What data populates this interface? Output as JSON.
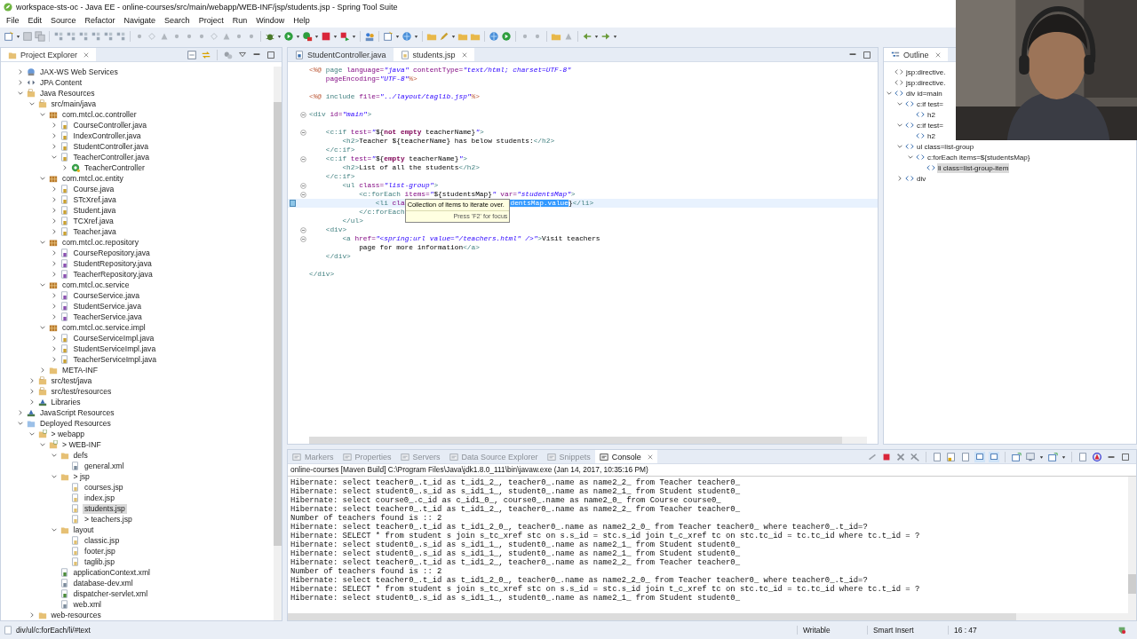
{
  "window": {
    "title": "workspace-sts-oc - Java EE - online-courses/src/main/webapp/WEB-INF/jsp/students.jsp - Spring Tool Suite"
  },
  "menu": [
    "File",
    "Edit",
    "Source",
    "Refactor",
    "Navigate",
    "Search",
    "Project",
    "Run",
    "Window",
    "Help"
  ],
  "project_explorer": {
    "title": "Project Explorer",
    "items": [
      {
        "label": "JAX-WS Web Services",
        "kind": "web-services",
        "expanded": false,
        "selected": false
      },
      {
        "label": "JPA Content",
        "kind": "jpa",
        "expanded": false,
        "selected": false
      },
      {
        "label": "Java Resources",
        "kind": "java-resources",
        "expanded": true,
        "selected": false,
        "children": [
          {
            "label": "src/main/java",
            "kind": "source-folder",
            "expanded": true,
            "selected": false,
            "children": [
              {
                "label": "com.mtcl.oc.controller",
                "kind": "package",
                "expanded": true,
                "selected": false,
                "children": [
                  {
                    "label": "CourseController.java",
                    "kind": "java-file",
                    "expanded": false,
                    "selected": false
                  },
                  {
                    "label": "IndexController.java",
                    "kind": "java-file",
                    "expanded": false,
                    "selected": false
                  },
                  {
                    "label": "StudentController.java",
                    "kind": "java-file",
                    "expanded": false,
                    "selected": false
                  },
                  {
                    "label": "TeacherController.java",
                    "kind": "java-file",
                    "expanded": true,
                    "selected": false,
                    "children": [
                      {
                        "label": "TeacherController",
                        "kind": "class",
                        "expanded": false,
                        "selected": false
                      }
                    ]
                  }
                ]
              },
              {
                "label": "com.mtcl.oc.entity",
                "kind": "package",
                "expanded": true,
                "selected": false,
                "children": [
                  {
                    "label": "Course.java",
                    "kind": "java-file",
                    "expanded": false,
                    "selected": false
                  },
                  {
                    "label": "STcXref.java",
                    "kind": "java-file",
                    "expanded": false,
                    "selected": false
                  },
                  {
                    "label": "Student.java",
                    "kind": "java-file",
                    "expanded": false,
                    "selected": false
                  },
                  {
                    "label": "TCXref.java",
                    "kind": "java-file",
                    "expanded": false,
                    "selected": false
                  },
                  {
                    "label": "Teacher.java",
                    "kind": "java-file",
                    "expanded": false,
                    "selected": false
                  }
                ]
              },
              {
                "label": "com.mtcl.oc.repository",
                "kind": "package",
                "expanded": true,
                "selected": false,
                "children": [
                  {
                    "label": "CourseRepository.java",
                    "kind": "interface-file",
                    "expanded": false,
                    "selected": false
                  },
                  {
                    "label": "StudentRepository.java",
                    "kind": "interface-file",
                    "expanded": false,
                    "selected": false
                  },
                  {
                    "label": "TeacherRepository.java",
                    "kind": "interface-file",
                    "expanded": false,
                    "selected": false
                  }
                ]
              },
              {
                "label": "com.mtcl.oc.service",
                "kind": "package",
                "expanded": true,
                "selected": false,
                "children": [
                  {
                    "label": "CourseService.java",
                    "kind": "interface-file",
                    "expanded": false,
                    "selected": false
                  },
                  {
                    "label": "StudentService.java",
                    "kind": "interface-file",
                    "expanded": false,
                    "selected": false
                  },
                  {
                    "label": "TeacherService.java",
                    "kind": "interface-file",
                    "expanded": false,
                    "selected": false
                  }
                ]
              },
              {
                "label": "com.mtcl.oc.service.impl",
                "kind": "package",
                "expanded": true,
                "selected": false,
                "children": [
                  {
                    "label": "CourseServiceImpl.java",
                    "kind": "java-file",
                    "expanded": false,
                    "selected": false
                  },
                  {
                    "label": "StudentServiceImpl.java",
                    "kind": "java-file",
                    "expanded": false,
                    "selected": false
                  },
                  {
                    "label": "TeacherServiceImpl.java",
                    "kind": "java-file",
                    "expanded": false,
                    "selected": false
                  }
                ]
              },
              {
                "label": "META-INF",
                "kind": "folder",
                "expanded": false,
                "selected": false
              }
            ]
          },
          {
            "label": "src/test/java",
            "kind": "source-folder",
            "expanded": false,
            "selected": false
          },
          {
            "label": "src/test/resources",
            "kind": "source-folder",
            "expanded": false,
            "selected": false
          },
          {
            "label": "Libraries",
            "kind": "libraries",
            "expanded": false,
            "selected": false
          }
        ]
      },
      {
        "label": "JavaScript Resources",
        "kind": "libraries",
        "expanded": false,
        "selected": false
      },
      {
        "label": "Deployed Resources",
        "kind": "deployed",
        "expanded": true,
        "selected": false,
        "children": [
          {
            "label": "> webapp",
            "kind": "web-folder",
            "expanded": true,
            "selected": false,
            "children": [
              {
                "label": "> WEB-INF",
                "kind": "web-folder",
                "expanded": true,
                "selected": false,
                "children": [
                  {
                    "label": "defs",
                    "kind": "folder",
                    "expanded": true,
                    "selected": false,
                    "children": [
                      {
                        "label": "general.xml",
                        "kind": "xml-file",
                        "selected": false
                      }
                    ]
                  },
                  {
                    "label": "> jsp",
                    "kind": "folder",
                    "expanded": true,
                    "selected": false,
                    "children": [
                      {
                        "label": "courses.jsp",
                        "kind": "jsp-file",
                        "selected": false
                      },
                      {
                        "label": "index.jsp",
                        "kind": "jsp-file",
                        "selected": false
                      },
                      {
                        "label": "students.jsp",
                        "kind": "jsp-file",
                        "selected": true
                      },
                      {
                        "label": "> teachers.jsp",
                        "kind": "jsp-file",
                        "selected": false
                      }
                    ]
                  },
                  {
                    "label": "layout",
                    "kind": "folder",
                    "expanded": true,
                    "selected": false,
                    "children": [
                      {
                        "label": "classic.jsp",
                        "kind": "jsp-file",
                        "selected": false
                      },
                      {
                        "label": "footer.jsp",
                        "kind": "jsp-file",
                        "selected": false
                      },
                      {
                        "label": "taglib.jsp",
                        "kind": "jsp-file",
                        "selected": false
                      }
                    ]
                  },
                  {
                    "label": "applicationContext.xml",
                    "kind": "spring-file",
                    "selected": false
                  },
                  {
                    "label": "database-dev.xml",
                    "kind": "xml-file",
                    "selected": false
                  },
                  {
                    "label": "dispatcher-servlet.xml",
                    "kind": "spring-file",
                    "selected": false
                  },
                  {
                    "label": "web.xml",
                    "kind": "xml-file",
                    "selected": false
                  }
                ]
              }
            ]
          },
          {
            "label": "web-resources",
            "kind": "folder",
            "expanded": false,
            "selected": false
          }
        ]
      }
    ]
  },
  "editor": {
    "tabs": [
      {
        "label": "StudentController.java",
        "selected": false
      },
      {
        "label": "students.jsp",
        "selected": true
      }
    ],
    "lines": [
      {
        "fold": false,
        "current": false,
        "segments": [
          {
            "kind": "delim",
            "text": "<%@"
          },
          {
            "kind": "tag",
            "text": " page"
          },
          {
            "kind": "attr",
            "text": " language="
          },
          {
            "kind": "string",
            "text": "\"java\""
          },
          {
            "kind": "attr",
            "text": " contentType="
          },
          {
            "kind": "string",
            "text": "\"text/html; charset=UTF-8\""
          }
        ]
      },
      {
        "fold": false,
        "current": false,
        "segments": [
          {
            "kind": "attr",
            "text": "    pageEncoding="
          },
          {
            "kind": "string",
            "text": "\"UTF-8\""
          },
          {
            "kind": "delim",
            "text": "%>"
          }
        ]
      },
      {
        "fold": false,
        "current": false
      },
      {
        "fold": false,
        "current": false,
        "segments": [
          {
            "kind": "delim",
            "text": "<%@"
          },
          {
            "kind": "tag",
            "text": " include"
          },
          {
            "kind": "attr",
            "text": " file="
          },
          {
            "kind": "string",
            "text": "\"../layout/taglib.jsp\""
          },
          {
            "kind": "delim",
            "text": "%>"
          }
        ]
      },
      {
        "fold": false,
        "current": false
      },
      {
        "fold": true,
        "current": false,
        "segments": [
          {
            "kind": "tag",
            "text": "<div"
          },
          {
            "kind": "attr",
            "text": " id="
          },
          {
            "kind": "string",
            "text": "\"main\""
          },
          {
            "kind": "tag",
            "text": ">"
          }
        ]
      },
      {
        "fold": false,
        "current": false
      },
      {
        "fold": true,
        "current": false,
        "segments": [
          {
            "kind": "tag",
            "text": "    <c:if"
          },
          {
            "kind": "attr",
            "text": " test="
          },
          {
            "kind": "string",
            "text": "\""
          },
          {
            "kind": "text",
            "text": "${"
          },
          {
            "kind": "keyword",
            "text": "not empty"
          },
          {
            "kind": "text",
            "text": " teacherName}"
          },
          {
            "kind": "string",
            "text": "\""
          },
          {
            "kind": "tag",
            "text": ">"
          }
        ]
      },
      {
        "fold": false,
        "current": false,
        "segments": [
          {
            "kind": "tag",
            "text": "        <h2>"
          },
          {
            "kind": "text",
            "text": "Teacher ${teacherName} has below students:"
          },
          {
            "kind": "tag",
            "text": "</h2>"
          }
        ]
      },
      {
        "fold": false,
        "current": false,
        "segments": [
          {
            "kind": "tag",
            "text": "    </c:if>"
          }
        ]
      },
      {
        "fold": true,
        "current": false,
        "segments": [
          {
            "kind": "tag",
            "text": "    <c:if"
          },
          {
            "kind": "attr",
            "text": " test="
          },
          {
            "kind": "string",
            "text": "\""
          },
          {
            "kind": "text",
            "text": "${"
          },
          {
            "kind": "keyword",
            "text": "empty"
          },
          {
            "kind": "text",
            "text": " teacherName}"
          },
          {
            "kind": "string",
            "text": "\""
          },
          {
            "kind": "tag",
            "text": ">"
          }
        ]
      },
      {
        "fold": false,
        "current": false,
        "segments": [
          {
            "kind": "tag",
            "text": "        <h2>"
          },
          {
            "kind": "text",
            "text": "List of all the students"
          },
          {
            "kind": "tag",
            "text": "</h2>"
          }
        ]
      },
      {
        "fold": false,
        "current": false,
        "segments": [
          {
            "kind": "tag",
            "text": "    </c:if>"
          }
        ]
      },
      {
        "fold": true,
        "current": false,
        "segments": [
          {
            "kind": "tag",
            "text": "        <ul"
          },
          {
            "kind": "attr",
            "text": " class="
          },
          {
            "kind": "string",
            "text": "\"list-group\""
          },
          {
            "kind": "tag",
            "text": ">"
          }
        ]
      },
      {
        "fold": true,
        "current": false,
        "segments": [
          {
            "kind": "tag",
            "text": "            <c:forEach"
          },
          {
            "kind": "attr",
            "text": " items="
          },
          {
            "kind": "string",
            "text": "\""
          },
          {
            "kind": "text",
            "text": "${studentsMap}"
          },
          {
            "kind": "string",
            "text": "\""
          },
          {
            "kind": "attr",
            "text": " var="
          },
          {
            "kind": "string",
            "text": "\"studentsMap\""
          },
          {
            "kind": "tag",
            "text": ">"
          }
        ]
      },
      {
        "fold": false,
        "current": true,
        "segments": [
          {
            "kind": "tag",
            "text": "                <li"
          },
          {
            "kind": "attr",
            "text": " cla"
          },
          {
            "kind": "tooltip"
          },
          {
            "kind": "selected",
            "text": "dentsMap.value"
          },
          {
            "kind": "text",
            "text": "}"
          },
          {
            "kind": "tag",
            "text": "</li>"
          }
        ]
      },
      {
        "fold": false,
        "current": false,
        "segments": [
          {
            "kind": "tag",
            "text": "            </c:forEach"
          }
        ]
      },
      {
        "fold": false,
        "current": false,
        "segments": [
          {
            "kind": "tag",
            "text": "        </ul>"
          }
        ]
      },
      {
        "fold": true,
        "current": false,
        "segments": [
          {
            "kind": "tag",
            "text": "    <div>"
          }
        ]
      },
      {
        "fold": true,
        "current": false,
        "segments": [
          {
            "kind": "tag",
            "text": "        <a"
          },
          {
            "kind": "attr",
            "text": " href="
          },
          {
            "kind": "string",
            "text": "\"<spring:url value=\"/teachers.html\" />\""
          },
          {
            "kind": "tag",
            "text": ">"
          },
          {
            "kind": "text",
            "text": "Visit teachers"
          }
        ]
      },
      {
        "fold": false,
        "current": false,
        "segments": [
          {
            "kind": "text",
            "text": "            page for more information"
          },
          {
            "kind": "tag",
            "text": "</a>"
          }
        ]
      },
      {
        "fold": false,
        "current": false,
        "segments": [
          {
            "kind": "tag",
            "text": "    </div>"
          }
        ]
      },
      {
        "fold": false,
        "current": false
      },
      {
        "fold": false,
        "current": false,
        "segments": [
          {
            "kind": "tag",
            "text": "</div>"
          }
        ]
      }
    ],
    "tooltip": {
      "text": "Collection of items to iterate over.",
      "hint": "Press 'F2' for focus"
    }
  },
  "outline": {
    "title": "Outline",
    "items": [
      {
        "label": "jsp:directive.",
        "kind": "directive",
        "selected": false
      },
      {
        "label": "jsp:directive.",
        "kind": "directive",
        "selected": false
      },
      {
        "label": "div id=main",
        "kind": "element",
        "expanded": true,
        "selected": false,
        "children": [
          {
            "label": "c:if test=",
            "kind": "element",
            "expanded": true,
            "selected": false,
            "children": [
              {
                "label": "h2",
                "kind": "element",
                "selected": false
              }
            ]
          },
          {
            "label": "c:if test=",
            "kind": "element",
            "expanded": true,
            "selected": false,
            "children": [
              {
                "label": "h2",
                "kind": "element",
                "selected": false
              }
            ]
          },
          {
            "label": "ul class=list-group",
            "kind": "element",
            "expanded": true,
            "selected": false,
            "children": [
              {
                "label": "c:forEach items=${studentsMap}",
                "kind": "element",
                "expanded": true,
                "selected": false,
                "children": [
                  {
                    "label": "li class=list-group-item",
                    "kind": "element",
                    "selected": true
                  }
                ]
              }
            ]
          },
          {
            "label": "div",
            "kind": "element",
            "expanded": false,
            "selected": false
          }
        ]
      }
    ]
  },
  "console": {
    "tabs": [
      {
        "label": "Markers",
        "selected": false
      },
      {
        "label": "Properties",
        "selected": false
      },
      {
        "label": "Servers",
        "selected": false
      },
      {
        "label": "Data Source Explorer",
        "selected": false
      },
      {
        "label": "Snippets",
        "selected": false
      },
      {
        "label": "Console",
        "selected": true
      }
    ],
    "header": "online-courses [Maven Build] C:\\Program Files\\Java\\jdk1.8.0_111\\bin\\javaw.exe (Jan 14, 2017, 10:35:16 PM)",
    "lines": [
      "Hibernate: select teacher0_.t_id as t_id1_2_, teacher0_.name as name2_2_ from Teacher teacher0_",
      "Hibernate: select student0_.s_id as s_id1_1_, student0_.name as name2_1_ from Student student0_",
      "Hibernate: select course0_.c_id as c_id1_0_, course0_.name as name2_0_ from Course course0_",
      "Hibernate: select teacher0_.t_id as t_id1_2_, teacher0_.name as name2_2_ from Teacher teacher0_",
      "Number of teachers found is :: 2",
      "Hibernate: select teacher0_.t_id as t_id1_2_0_, teacher0_.name as name2_2_0_ from Teacher teacher0_ where teacher0_.t_id=?",
      "Hibernate: SELECT * from student s join s_tc_xref stc on s.s_id = stc.s_id join t_c_xref tc on stc.tc_id = tc.tc_id where tc.t_id = ?",
      "Hibernate: select student0_.s_id as s_id1_1_, student0_.name as name2_1_ from Student student0_",
      "Hibernate: select student0_.s_id as s_id1_1_, student0_.name as name2_1_ from Student student0_",
      "Hibernate: select teacher0_.t_id as t_id1_2_, teacher0_.name as name2_2_ from Teacher teacher0_",
      "Number of teachers found is :: 2",
      "Hibernate: select teacher0_.t_id as t_id1_2_0_, teacher0_.name as name2_2_0_ from Teacher teacher0_ where teacher0_.t_id=?",
      "Hibernate: SELECT * from student s join s_tc_xref stc on s.s_id = stc.s_id join t_c_xref tc on stc.tc_id = tc.tc_id where tc.t_id = ?",
      "Hibernate: select student0_.s_id as s_id1_1_, student0_.name as name2_1_ from Student student0_"
    ]
  },
  "status_bar": {
    "path": "div/ul/c:forEach/li/#text",
    "mode": "Writable",
    "insert": "Smart Insert",
    "position": "16 : 47"
  }
}
